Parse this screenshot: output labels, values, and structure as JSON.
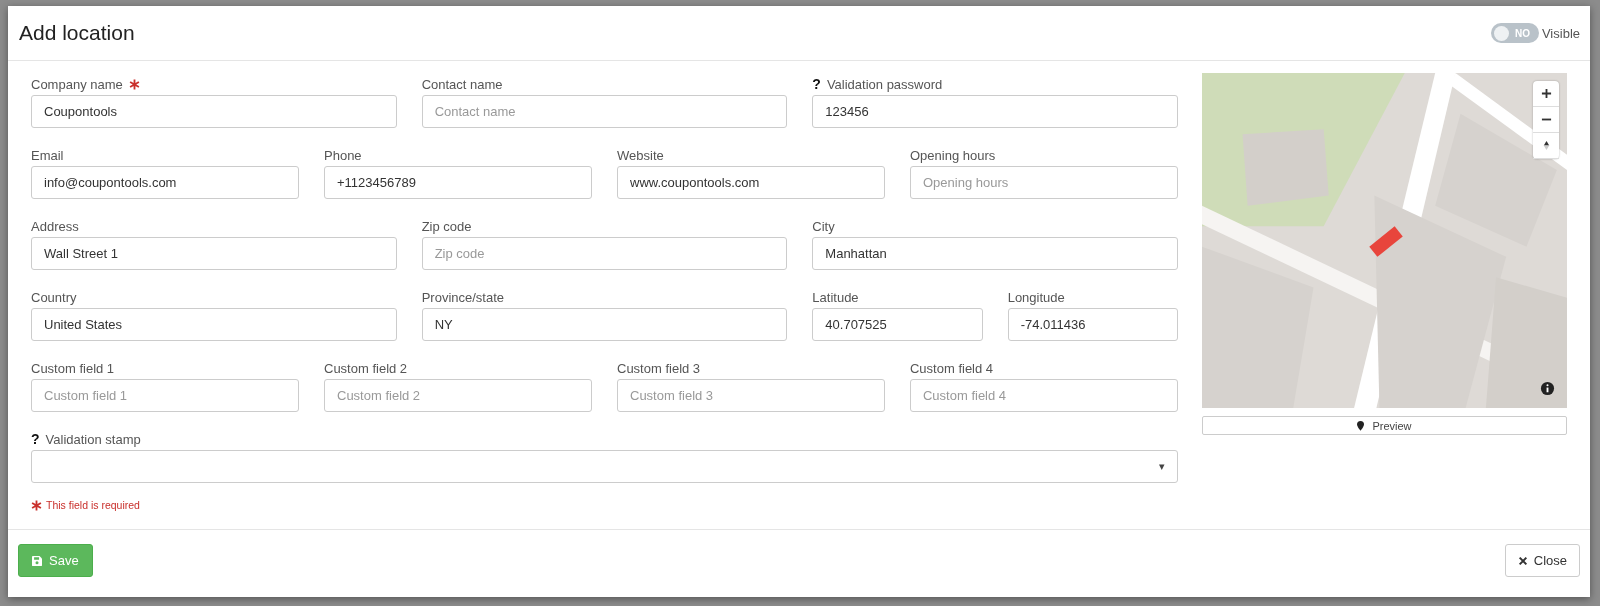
{
  "dialog": {
    "title": "Add location"
  },
  "visibility": {
    "on": false,
    "state_text": "NO",
    "label": "Visible"
  },
  "rows": [
    [
      {
        "label": "Company name",
        "required": true,
        "value": "Coupontools"
      },
      {
        "label": "Contact name",
        "required": false,
        "placeholder": "Contact name"
      },
      {
        "label": "Validation password",
        "required": false,
        "help": "?",
        "value": "123456"
      }
    ],
    [
      {
        "label": "Email",
        "required": false,
        "value": "info@coupontools.com"
      },
      {
        "label": "Phone",
        "required": false,
        "value": "+1123456789"
      },
      {
        "label": "Website",
        "required": false,
        "value": "www.coupontools.com"
      },
      {
        "label": "Opening hours",
        "required": false,
        "placeholder": "Opening hours"
      }
    ],
    [
      {
        "label": "Address",
        "required": false,
        "value": "Wall Street 1"
      },
      {
        "label": "Zip code",
        "required": false,
        "placeholder": "Zip code"
      },
      {
        "label": "City",
        "required": false,
        "value": "Manhattan"
      }
    ],
    [
      {
        "label": "Country",
        "required": false,
        "value": "United States"
      },
      {
        "label": "Province/state",
        "required": false,
        "value": "NY"
      },
      {
        "label": "Latitude",
        "required": false,
        "value": "40.707525"
      },
      {
        "label": "Longitude",
        "required": false,
        "value": "-74.011436"
      }
    ],
    [
      {
        "label": "Custom field 1",
        "required": false,
        "placeholder": "Custom field 1"
      },
      {
        "label": "Custom field 2",
        "required": false,
        "placeholder": "Custom field 2"
      },
      {
        "label": "Custom field 3",
        "required": false,
        "placeholder": "Custom field 3"
      },
      {
        "label": "Custom field 4",
        "required": false,
        "placeholder": "Custom field 4"
      }
    ]
  ],
  "stamp": {
    "label": "Validation stamp",
    "help": "?",
    "caret": "▾"
  },
  "required_note": "This field is required",
  "map": {
    "kind": "picture",
    "preview_button": "Preview"
  },
  "buttons": {
    "save": "Save",
    "close": "Close"
  }
}
